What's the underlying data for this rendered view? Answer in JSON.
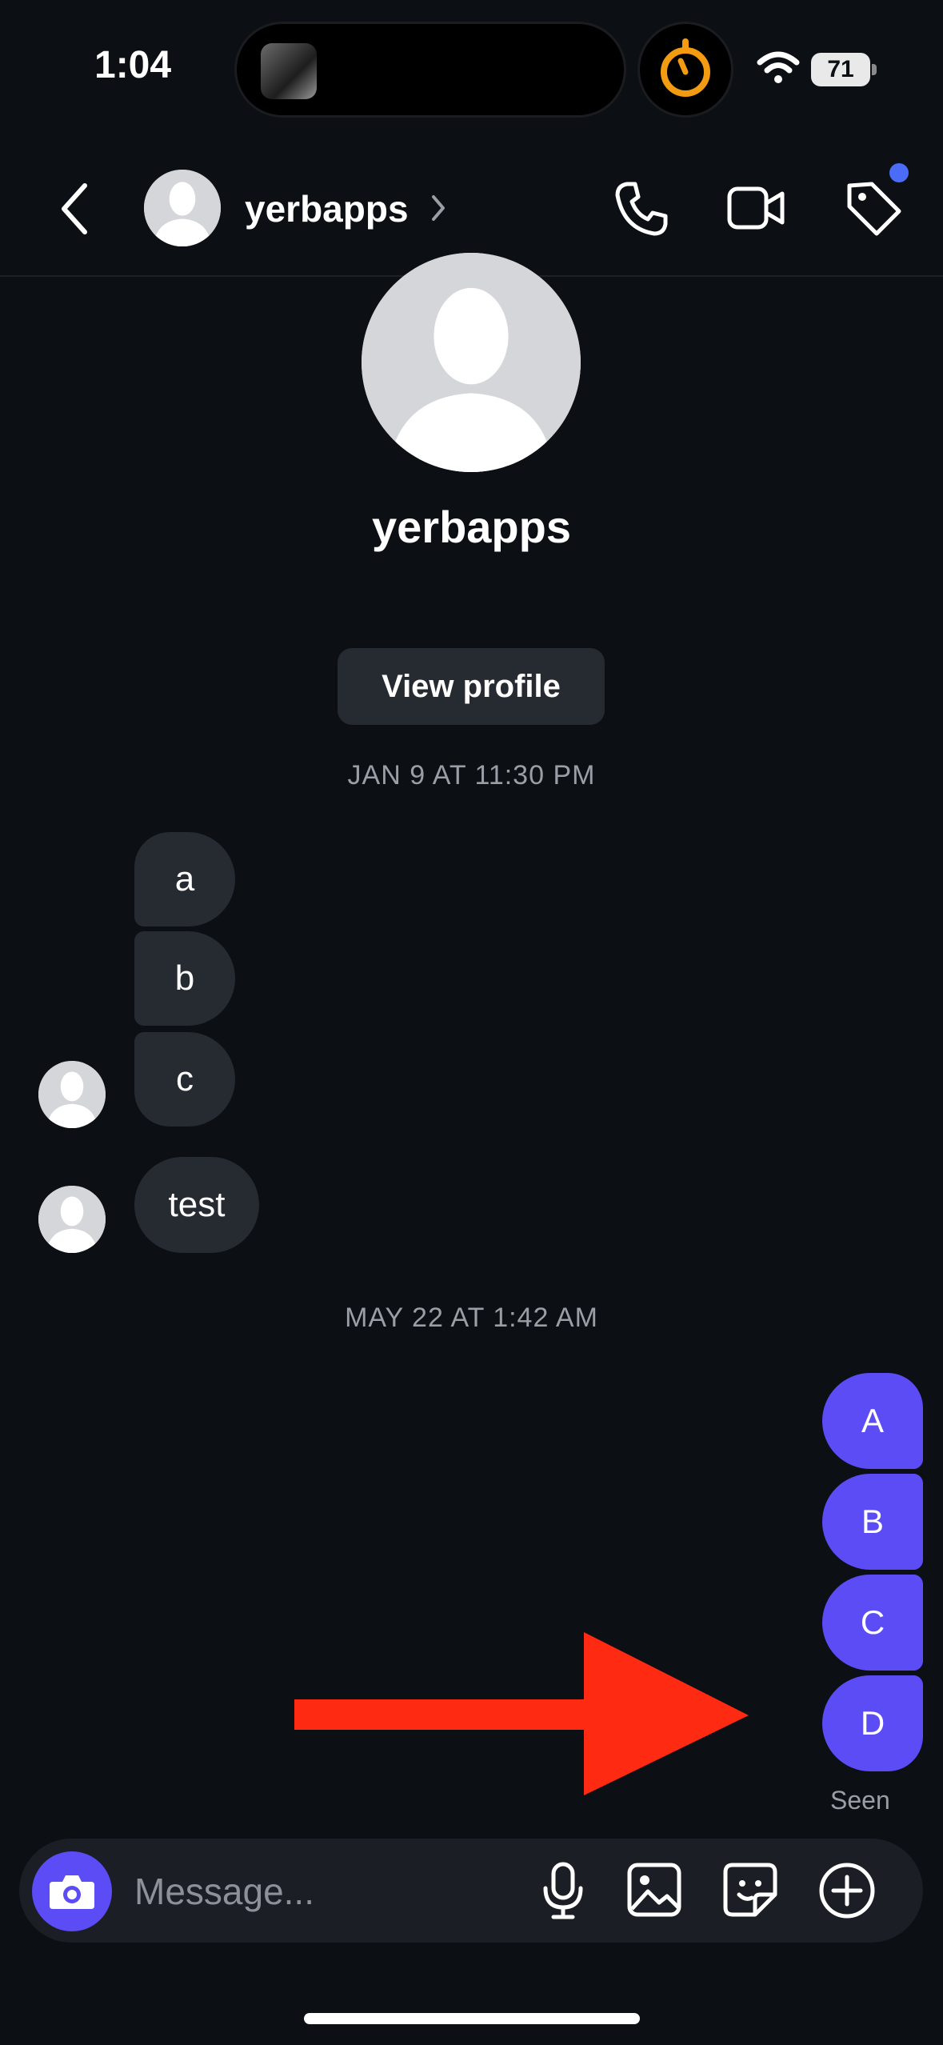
{
  "status_bar": {
    "time": "1:04",
    "battery": "71"
  },
  "header": {
    "name": "yerbapps",
    "icons": [
      "back-chevron-icon",
      "phone-icon",
      "video-camera-icon",
      "tag-icon"
    ]
  },
  "profile": {
    "name": "yerbapps",
    "view_profile_label": "View profile"
  },
  "conversation": {
    "date_1": "JAN 9 AT 11:30 PM",
    "incoming_group_1": [
      "a",
      "b",
      "c"
    ],
    "incoming_2": "test",
    "date_2": "MAY 22 AT 1:42 AM",
    "outgoing": [
      "A",
      "B",
      "C",
      "D"
    ],
    "seen_label": "Seen"
  },
  "composer": {
    "placeholder": "Message...",
    "icons": [
      "camera-icon",
      "microphone-icon",
      "gallery-icon",
      "sticker-icon",
      "add-icon"
    ]
  },
  "colors": {
    "background": "#0c0f14",
    "incoming_bubble": "#262a31",
    "outgoing_bubble": "#5b4cf5",
    "annotation_arrow": "#ff2a12",
    "timer_orange": "#f39c12"
  }
}
